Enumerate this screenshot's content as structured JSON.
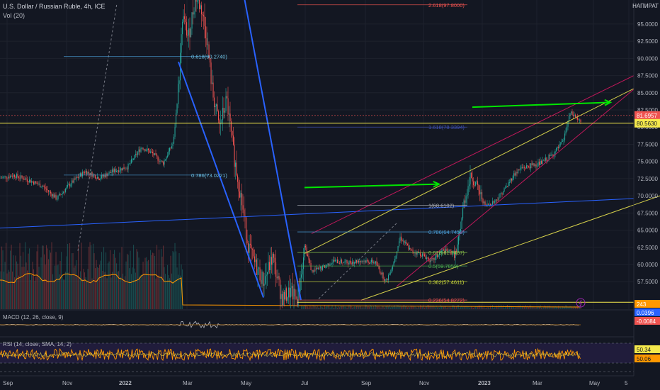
{
  "header": {
    "symbol": "U.S. Dollar / Russian Ruble, 4h, ICE",
    "volume": "Vol (20)",
    "brand": "НАПИРАТ"
  },
  "panes": {
    "macd_label": "MACD (12, 26, close, 9)",
    "rsi_label": "RSI (14, close, SMA, 14, 2)"
  },
  "colors": {
    "background": "#131722",
    "grid": "#1e222d",
    "up": "#26a69a",
    "down": "#ef5350",
    "trend_blue": "#2962ff",
    "channel_yellow": "#d4cf4a",
    "channel_red": "#c2185b",
    "arrow_green": "#00e600",
    "fib": "#4a9fd8",
    "rsi_line": "#ff9800",
    "rsi_band": "#2a1f4d"
  },
  "chart_data": {
    "type": "candlestick",
    "y_axis_ticks": [
      "95.0000",
      "92.5000",
      "90.0000",
      "87.5000",
      "85.0000",
      "82.5000",
      "80.0000",
      "77.5000",
      "75.0000",
      "72.5000",
      "70.0000",
      "67.5000",
      "65.0000",
      "62.5000",
      "60.0000",
      "57.5000"
    ],
    "ylim": [
      53.5,
      98.5
    ],
    "x_axis_ticks": [
      "Sep",
      "Nov",
      "2022",
      "Mar",
      "May",
      "Jul",
      "Sep",
      "Nov",
      "2023",
      "Mar",
      "May",
      "5"
    ],
    "price_badges": [
      {
        "text": "81.6957",
        "color": "#ef5350",
        "value": 81.6957
      },
      {
        "text": "80.5630",
        "color": "#f5e94c",
        "value": 80.563
      }
    ],
    "macd_badges": [
      {
        "text": "243",
        "color": "#ff9800"
      },
      {
        "text": "0.0396",
        "color": "#2962ff"
      },
      {
        "text": "-0.0084",
        "color": "#ef5350"
      }
    ],
    "rsi_badges": [
      {
        "text": "50.34",
        "color": "#f5e94c"
      },
      {
        "text": "50.06",
        "color": "#ff9800"
      }
    ],
    "fib_left": [
      {
        "label": "0.618(90.2740)",
        "value": 90.274
      },
      {
        "label": "0.786(73.0221)",
        "value": 73.0221
      }
    ],
    "fib_right": [
      {
        "label": "2.618(97.8000)",
        "value": 97.8
      },
      {
        "label": "1.618(78.3394)",
        "value": 80.0
      },
      {
        "label": "1(68.6102)",
        "value": 68.6102
      },
      {
        "label": "0.786(64.7456)",
        "value": 64.7456
      },
      {
        "label": "0.618(61.7487)",
        "value": 61.7487
      },
      {
        "label": "0.5(59.7859)",
        "value": 59.7859
      },
      {
        "label": "0.382(57.4611)",
        "value": 57.4611
      },
      {
        "label": "0.236(54.8272)",
        "value": 54.8272
      }
    ],
    "price_path": [
      [
        0,
        72.6
      ],
      [
        20,
        73.0
      ],
      [
        40,
        72.3
      ],
      [
        60,
        71.4
      ],
      [
        80,
        69.6
      ],
      [
        100,
        71.8
      ],
      [
        120,
        73.6
      ],
      [
        140,
        72.6
      ],
      [
        160,
        73.6
      ],
      [
        180,
        74.2
      ],
      [
        200,
        77.1
      ],
      [
        215,
        76.2
      ],
      [
        230,
        74.7
      ],
      [
        245,
        77.8
      ],
      [
        252,
        86
      ],
      [
        258,
        96
      ],
      [
        266,
        93
      ],
      [
        276,
        99
      ],
      [
        285,
        97
      ],
      [
        292,
        93
      ],
      [
        300,
        85
      ],
      [
        310,
        80
      ],
      [
        320,
        84
      ],
      [
        330,
        76
      ],
      [
        340,
        70
      ],
      [
        350,
        63
      ],
      [
        360,
        60
      ],
      [
        372,
        57.5
      ],
      [
        385,
        61
      ],
      [
        398,
        55
      ],
      [
        410,
        56
      ],
      [
        420,
        54.8
      ],
      [
        430,
        63
      ],
      [
        440,
        59
      ],
      [
        455,
        59.5
      ],
      [
        470,
        60.5
      ],
      [
        490,
        60.3
      ],
      [
        510,
        60.6
      ],
      [
        530,
        60.3
      ],
      [
        545,
        57.5
      ],
      [
        555,
        60
      ],
      [
        565,
        64
      ],
      [
        580,
        62
      ],
      [
        595,
        61.5
      ],
      [
        610,
        60.5
      ],
      [
        625,
        62
      ],
      [
        645,
        61.6
      ],
      [
        655,
        69
      ],
      [
        665,
        73
      ],
      [
        675,
        71
      ],
      [
        685,
        68.5
      ],
      [
        700,
        69.3
      ],
      [
        715,
        71.3
      ],
      [
        725,
        73
      ],
      [
        735,
        74
      ],
      [
        750,
        74.4
      ],
      [
        765,
        74.8
      ],
      [
        780,
        76
      ],
      [
        795,
        77.8
      ],
      [
        805,
        82
      ],
      [
        812,
        81.6
      ],
      [
        820,
        80.6
      ]
    ]
  }
}
